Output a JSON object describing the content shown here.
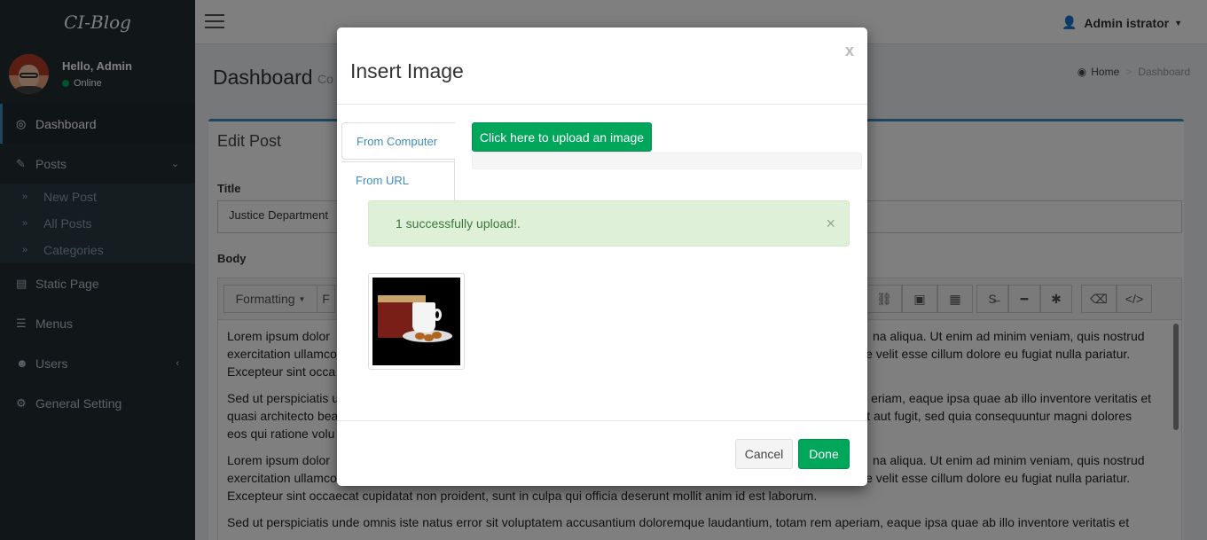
{
  "brand": "CI-Blog",
  "user": {
    "greeting": "Hello, Admin",
    "status": "Online"
  },
  "sidebar": {
    "items": [
      {
        "label": "Dashboard",
        "icon": "dashboard-icon"
      },
      {
        "label": "Posts",
        "icon": "edit-icon",
        "sub": [
          "New Post",
          "All Posts",
          "Categories"
        ]
      },
      {
        "label": "Static Page",
        "icon": "file-icon"
      },
      {
        "label": "Menus",
        "icon": "list-icon"
      },
      {
        "label": "Users",
        "icon": "users-icon"
      },
      {
        "label": "General Setting",
        "icon": "gear-icon"
      }
    ]
  },
  "header": {
    "user_menu": "Admin istrator"
  },
  "page": {
    "title": "Dashboard",
    "subtitle": "Co",
    "breadcrumb": {
      "home": "Home",
      "current": "Dashboard"
    }
  },
  "edit_post": {
    "title": "Edit Post",
    "title_label": "Title",
    "title_value": "Justice Department",
    "body_label": "Body",
    "toolbar": {
      "formatting": "Formatting",
      "next": "F"
    },
    "body": {
      "p1": [
        "Lorem ipsum dolor",
        "na aliqua. Ut enim ad minim veniam, quis nostrud",
        "exercitation ullamco",
        "ptate velit esse cillum dolore eu fugiat nulla pariatur.",
        "Excepteur sint occa"
      ],
      "p2": [
        "Sed ut perspiciatis u",
        "eriam, eaque ipsa quae ab illo inventore veritatis et",
        "quasi architecto bea",
        "dit aut fugit, sed quia consequuntur magni dolores",
        "eos qui ratione volu"
      ],
      "p3": [
        "Lorem ipsum dolor",
        "na aliqua. Ut enim ad minim veniam, quis nostrud",
        "exercitation ullamco",
        "ptate velit esse cillum dolore eu fugiat nulla pariatur.",
        "Excepteur sint occaecat cupidatat non proident, sunt in culpa qui officia deserunt mollit anim id est laborum."
      ],
      "p4": "Sed ut perspiciatis unde omnis iste natus error sit voluptatem accusantium doloremque laudantium, totam rem aperiam, eaque ipsa quae ab illo inventore veritatis et"
    }
  },
  "modal": {
    "title": "Insert Image",
    "close": "x",
    "tabs": [
      "From Computer",
      "From URL"
    ],
    "upload_button": "Click here to upload an image",
    "progress": 0,
    "alert": "1 successfully upload!.",
    "alert_close": "×",
    "cancel": "Cancel",
    "done": "Done"
  }
}
